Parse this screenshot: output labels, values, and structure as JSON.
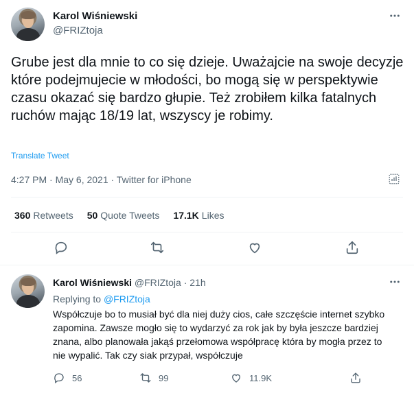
{
  "main_tweet": {
    "author_name": "Karol Wiśniewski",
    "author_handle": "@FRIZtoja",
    "text": "Grube jest dla mnie to co się dzieje. Uważajcie na swoje decyzje które podejmujecie w młodości, bo mogą się w perspektywie czasu okazać się bardzo głupie. Też zrobiłem kilka fatalnych ruchów mając 18/19 lat, wszyscy je robimy.",
    "translate_label": "Translate Tweet",
    "timestamp": "4:27 PM · May 6, 2021 · Twitter for iPhone",
    "stats": {
      "retweets_count": "360",
      "retweets_label": "Retweets",
      "quote_count": "50",
      "quote_label": "Quote Tweets",
      "likes_count": "17.1K",
      "likes_label": "Likes"
    }
  },
  "reply_tweet": {
    "author_name": "Karol Wiśniewski",
    "author_handle": "@FRIZtoja",
    "separator": "·",
    "age": "21h",
    "replying_prefix": "Replying to",
    "replying_handle": "@FRIZtoja",
    "text": "Współczuje bo to musiał być dla niej duży cios, całe szczęście internet szybko zapomina. Zawsze mogło się to wydarzyć za rok jak by była jeszcze bardziej znana, albo planowała jakąś przełomowa współpracę która by mogła przez to nie wypalić. Tak czy siak przypał, współczuje",
    "actions": {
      "replies": "56",
      "retweets": "99",
      "likes": "11.9K"
    }
  },
  "icons": {
    "reply": "reply-icon",
    "retweet": "retweet-icon",
    "like": "heart-icon",
    "share": "share-icon",
    "more": "more-icon",
    "analytics": "analytics-icon"
  },
  "colors": {
    "link": "#1d9bf0",
    "secondary_text": "#536471",
    "primary_text": "#0f1419",
    "divider": "#eff3f4"
  }
}
